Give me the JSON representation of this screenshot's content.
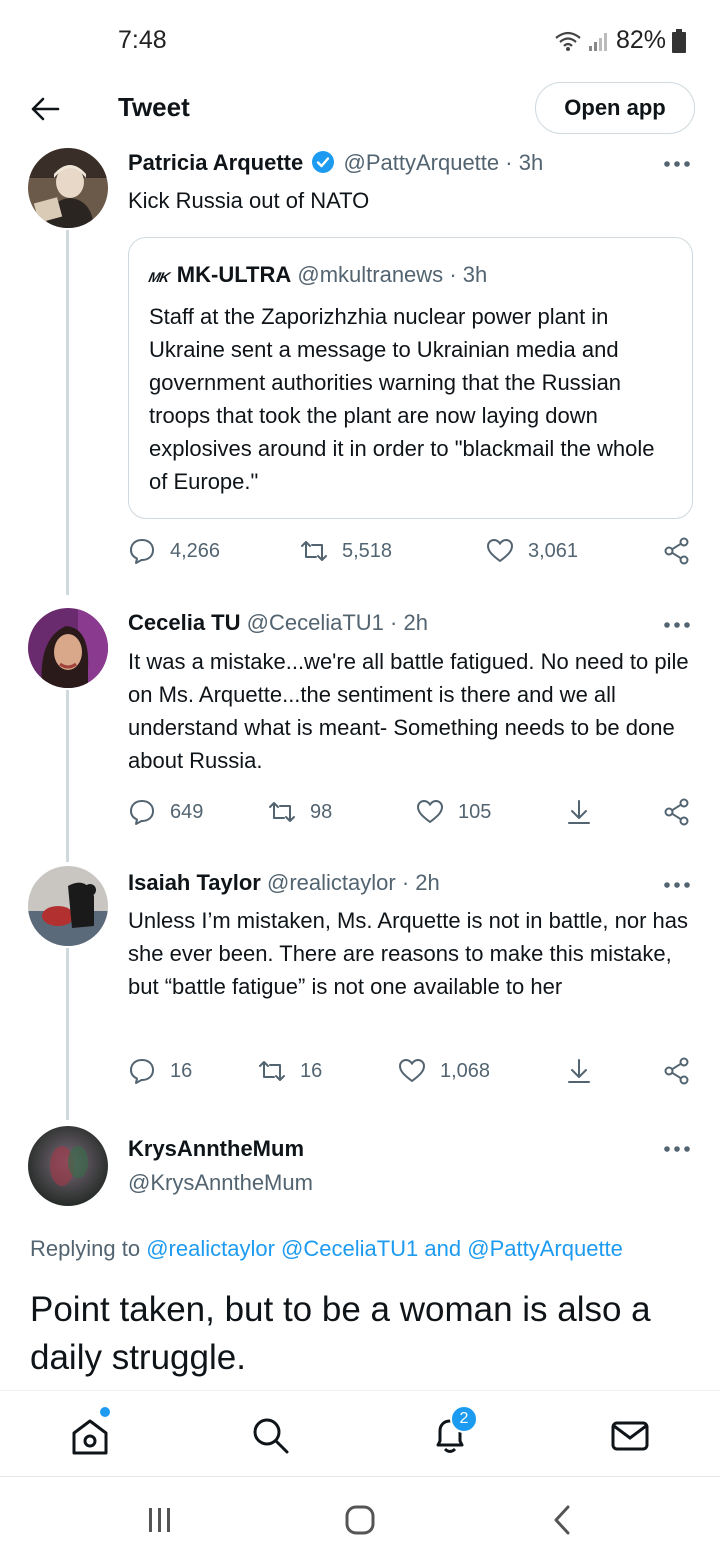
{
  "status_bar": {
    "time": "7:48",
    "battery": "82%"
  },
  "header": {
    "title": "Tweet",
    "open_app_label": "Open app"
  },
  "tweets": [
    {
      "name": "Patricia Arquette",
      "handle": "@PattyArquette",
      "time": "3h",
      "verified": true,
      "text": "Kick Russia out of NATO",
      "quote": {
        "name": "MK-ULTRA",
        "logo_text": "MK",
        "handle": "@mkultranews",
        "time": "3h",
        "text": "Staff at the Zaporizhzhia nuclear power plant in Ukraine sent a message to Ukrainian media and government authorities warning that the Russian troops that took the plant are now laying down explosives around it in order to \"blackmail the whole of Europe.\""
      },
      "replies": "4,266",
      "retweets": "5,518",
      "likes": "3,061"
    },
    {
      "name": "Cecelia TU",
      "handle": "@CeceliaTU1",
      "time": "2h",
      "text": "It was a mistake...we're all battle fatigued. No need to pile on Ms. Arquette...the sentiment is there and we all understand what is meant- Something needs to be done about Russia.",
      "replies": "649",
      "retweets": "98",
      "likes": "105"
    },
    {
      "name": "Isaiah Taylor",
      "handle": "@realictaylor",
      "time": "2h",
      "text": "Unless I’m mistaken, Ms. Arquette is not in battle, nor has she ever been. There are reasons to make this mistake, but “battle fatigue” is not one available to her",
      "replies": "16",
      "retweets": "16",
      "likes": "1,068"
    }
  ],
  "main_tweet": {
    "name": "KrysAnntheMum",
    "handle": "@KrysAnntheMum",
    "replying_prefix": "Replying to",
    "mention_1": "@realictaylor",
    "mention_2": "@CeceliaTU1",
    "and_word": "and",
    "mention_3": "@PattyArquette",
    "text": "Point taken, but to be a woman is also a daily struggle."
  },
  "bottom_nav": {
    "items": [
      "home-icon",
      "search-icon",
      "notifications-icon",
      "messages-icon"
    ],
    "notification_count": "2"
  },
  "colors": {
    "accent": "#1d9bf0",
    "text": "#0f1419",
    "secondary": "#536471",
    "border": "#cfd9de"
  }
}
